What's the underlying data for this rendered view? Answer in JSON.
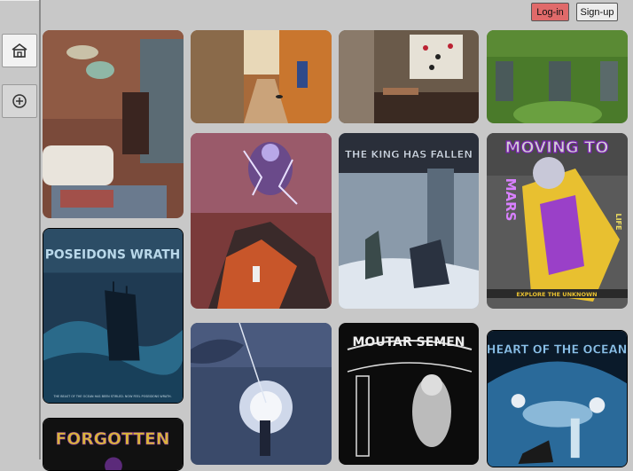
{
  "header": {
    "login_label": "Log-in",
    "signup_label": "Sign-up"
  },
  "sidebar": {
    "items": [
      {
        "icon": "home-icon"
      },
      {
        "icon": "plus-circle-icon"
      }
    ]
  },
  "gallery": {
    "posters": [
      {
        "title": "POSEIDONS WRATH",
        "caption": "THE BEAST OF THE OCEAN HAS BEEN STIRLED. NOW FEEL POSEIDONS WRATH."
      },
      {
        "title": "FORGOTTEN"
      },
      {
        "title": "THE KING HAS FALLEN"
      },
      {
        "title": "MOVING TO",
        "subtitle": "MARS",
        "side_text": "LIFE",
        "footer": "EXPLORE THE UNKNOWN"
      },
      {
        "title": "MOUTAR SEMEN"
      },
      {
        "title": "HEART OF THE OCEAN"
      }
    ]
  }
}
